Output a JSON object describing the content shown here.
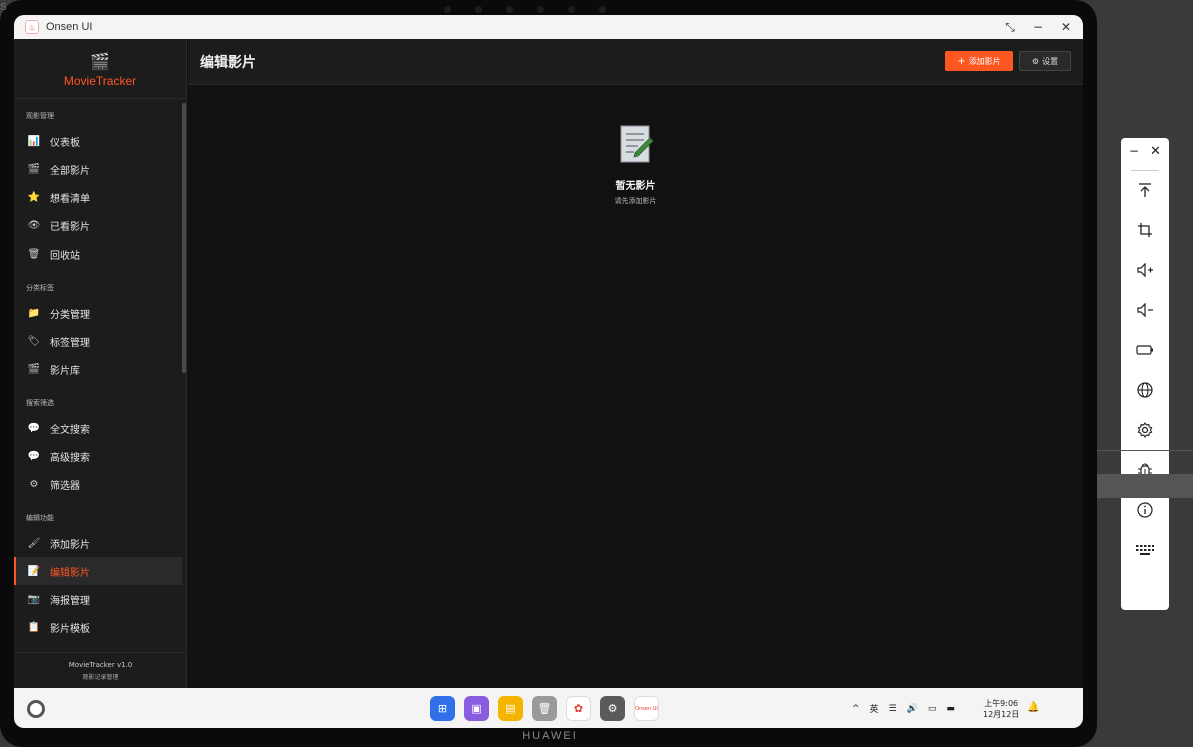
{
  "device": {
    "brand": "HUAWEI",
    "corner_text": "S"
  },
  "window": {
    "title": "Onsen UI",
    "app_icon_text": "Onsen UI"
  },
  "sidebar": {
    "brand_name": "MovieTracker",
    "sections": [
      {
        "title": "观影管理",
        "items": [
          {
            "label": "仪表板",
            "icon": "chart-icon",
            "glyph": "📊"
          },
          {
            "label": "全部影片",
            "icon": "clapper-icon",
            "glyph": "🎬"
          },
          {
            "label": "想看清单",
            "icon": "star-icon",
            "glyph": "⭐"
          },
          {
            "label": "已看影片",
            "icon": "eye-icon",
            "glyph": "👁"
          },
          {
            "label": "回收站",
            "icon": "trash-icon",
            "glyph": "🗑"
          }
        ]
      },
      {
        "title": "分类标签",
        "items": [
          {
            "label": "分类管理",
            "icon": "folder-icon",
            "glyph": "📁"
          },
          {
            "label": "标签管理",
            "icon": "tag-icon",
            "glyph": "🏷"
          },
          {
            "label": "影片库",
            "icon": "clapper-icon",
            "glyph": "🎬"
          }
        ]
      },
      {
        "title": "搜索筛选",
        "items": [
          {
            "label": "全文搜索",
            "icon": "chat-bubble-icon",
            "glyph": "💬"
          },
          {
            "label": "高级搜索",
            "icon": "chat-bubble-icon",
            "glyph": "💬"
          },
          {
            "label": "筛选器",
            "icon": "gear-icon",
            "glyph": "⚙"
          }
        ]
      },
      {
        "title": "编辑功能",
        "items": [
          {
            "label": "添加影片",
            "icon": "brush-icon",
            "glyph": "🖌"
          },
          {
            "label": "编辑影片",
            "icon": "edit-document-icon",
            "glyph": "📝",
            "active": true
          },
          {
            "label": "海报管理",
            "icon": "camera-icon",
            "glyph": "📷"
          },
          {
            "label": "影片模板",
            "icon": "clipboard-icon",
            "glyph": "📋"
          }
        ]
      }
    ],
    "footer": {
      "version": "MovieTracker v1.0",
      "subtitle": "观影记录管理"
    }
  },
  "header": {
    "title": "编辑影片",
    "add_button": "添加影片",
    "add_icon": "+",
    "settings_button": "设置",
    "settings_icon": "⚙"
  },
  "empty_state": {
    "title": "暂无影片",
    "subtitle": "请先添加影片",
    "icon": "document-edit-icon"
  },
  "taskbar": {
    "dock_apps": [
      {
        "name": "app-grid",
        "color": "#2f6fe8",
        "glyph": "⊞"
      },
      {
        "name": "multiwindow",
        "color": "#8a5ce0",
        "glyph": "▣"
      },
      {
        "name": "notes",
        "color": "#f4b400",
        "glyph": "▤"
      },
      {
        "name": "trash",
        "color": "#9a9a9a",
        "glyph": "🗑"
      },
      {
        "name": "photos",
        "color": "#ffffff",
        "glyph": "✿"
      },
      {
        "name": "settings",
        "color": "#5a5a5a",
        "glyph": "⚙"
      },
      {
        "name": "onsen-ui",
        "color": "#ffffff",
        "glyph": "Onsen UI"
      }
    ],
    "tray": {
      "chevron": "^",
      "ime": "英",
      "clock_line1": "上午9:06",
      "clock_line2": "12月12日"
    }
  },
  "colors": {
    "accent": "#ff5722",
    "sidebar_bg": "#1c1c1c",
    "content_bg": "#111111"
  }
}
